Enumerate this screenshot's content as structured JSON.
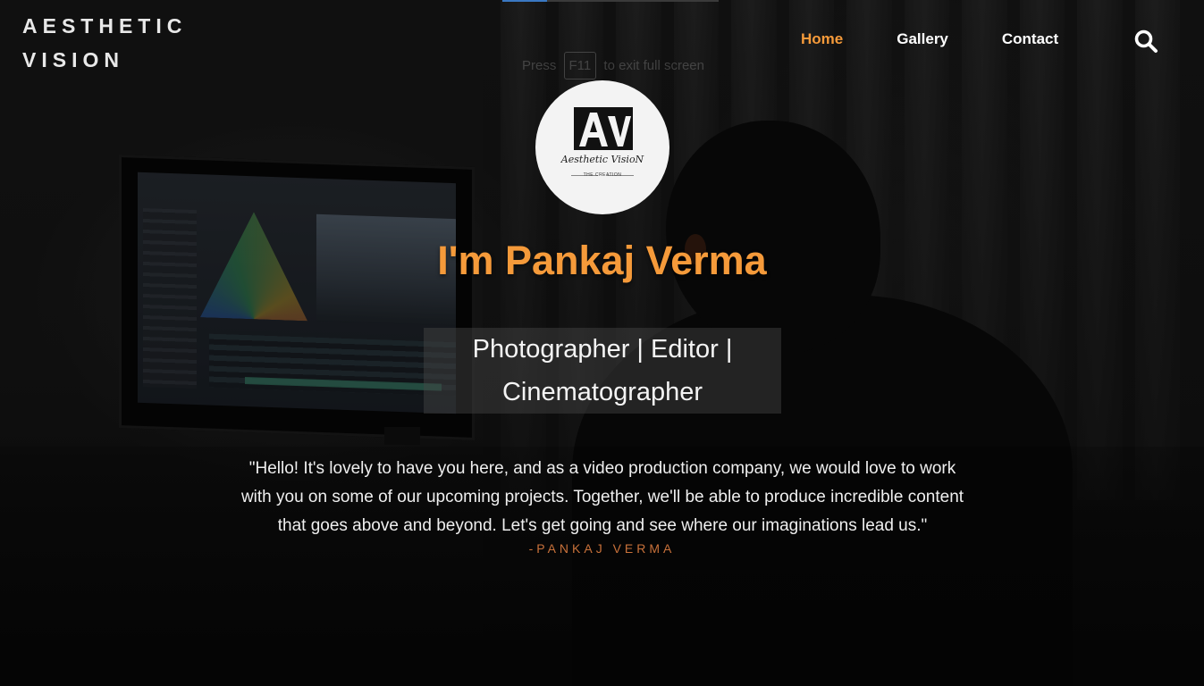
{
  "header": {
    "brand_line1": "AESTHETIC",
    "brand_line2": "VISION",
    "nav": [
      {
        "label": "Home",
        "active": true
      },
      {
        "label": "Gallery",
        "active": false
      },
      {
        "label": "Contact",
        "active": false
      }
    ],
    "search_icon": "search-icon"
  },
  "fullscreen_notice": {
    "prefix": "Press",
    "key": "F11",
    "suffix": "to exit full screen"
  },
  "logo": {
    "mark_text": "AV",
    "script_text": "Aesthetic VisioN",
    "sub_text": "THE CREATION"
  },
  "hero": {
    "headline": "I'm Pankaj Verma",
    "roles": "Photographer | Editor | Cinematographer",
    "quote": "\"Hello! It's lovely to have you here, and as a video production company, we would love to work with you on some of our upcoming projects. Together, we'll be able to produce incredible content that goes above and beyond. Let's get going and see where our imaginations lead us.\"",
    "author": "-PANKAJ VERMA"
  },
  "colors": {
    "accent": "#f59a3a",
    "author": "#c8713a",
    "background": "#141414",
    "text": "#ffffff"
  }
}
